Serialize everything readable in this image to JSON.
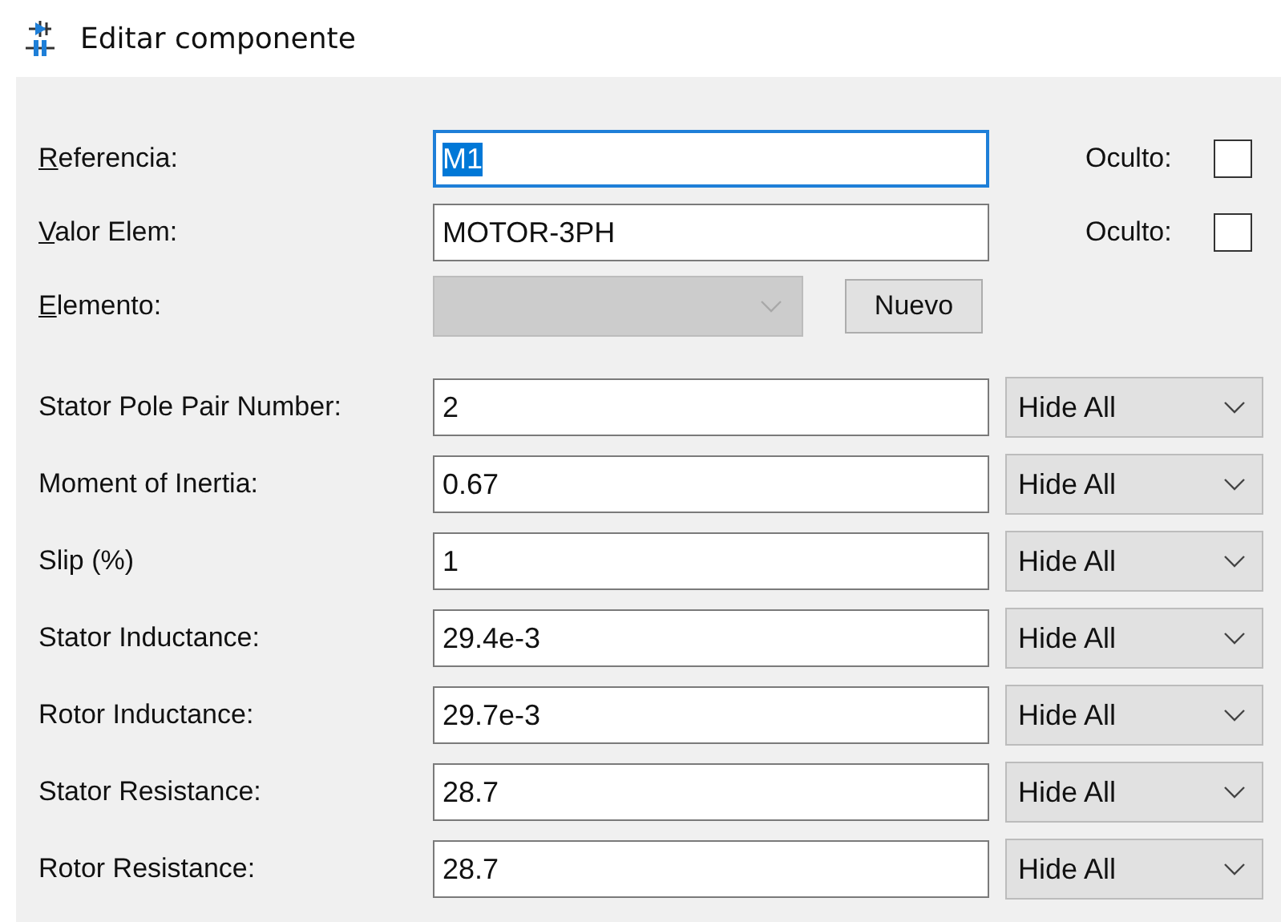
{
  "window": {
    "title": "Editar componente"
  },
  "fields": [
    {
      "kind": "text",
      "label": "Referencia:",
      "value": "M1",
      "focused": true,
      "hidden_label": "Oculto:",
      "hidden_checked": false
    },
    {
      "kind": "text",
      "label": "Valor Elem:",
      "value": "MOTOR-3PH",
      "focused": false,
      "hidden_label": "Oculto:",
      "hidden_checked": false
    },
    {
      "kind": "combo",
      "label": "Elemento:",
      "disabled": true,
      "button": "Nuevo"
    }
  ],
  "parameters": [
    {
      "label": "Stator Pole Pair Number:",
      "value": "2",
      "visibility": "Hide All"
    },
    {
      "label": "Moment of Inertia:",
      "value": "0.67",
      "visibility": "Hide All"
    },
    {
      "label": "Slip (%)",
      "value": "1",
      "visibility": "Hide All"
    },
    {
      "label": "Stator Inductance:",
      "value": "29.4e-3",
      "visibility": "Hide All"
    },
    {
      "label": "Rotor Inductance:",
      "value": "29.7e-3",
      "visibility": "Hide All"
    },
    {
      "label": "Stator Resistance:",
      "value": "28.7",
      "visibility": "Hide All"
    },
    {
      "label": "Rotor Resistance:",
      "value": "28.7",
      "visibility": "Hide All"
    }
  ]
}
